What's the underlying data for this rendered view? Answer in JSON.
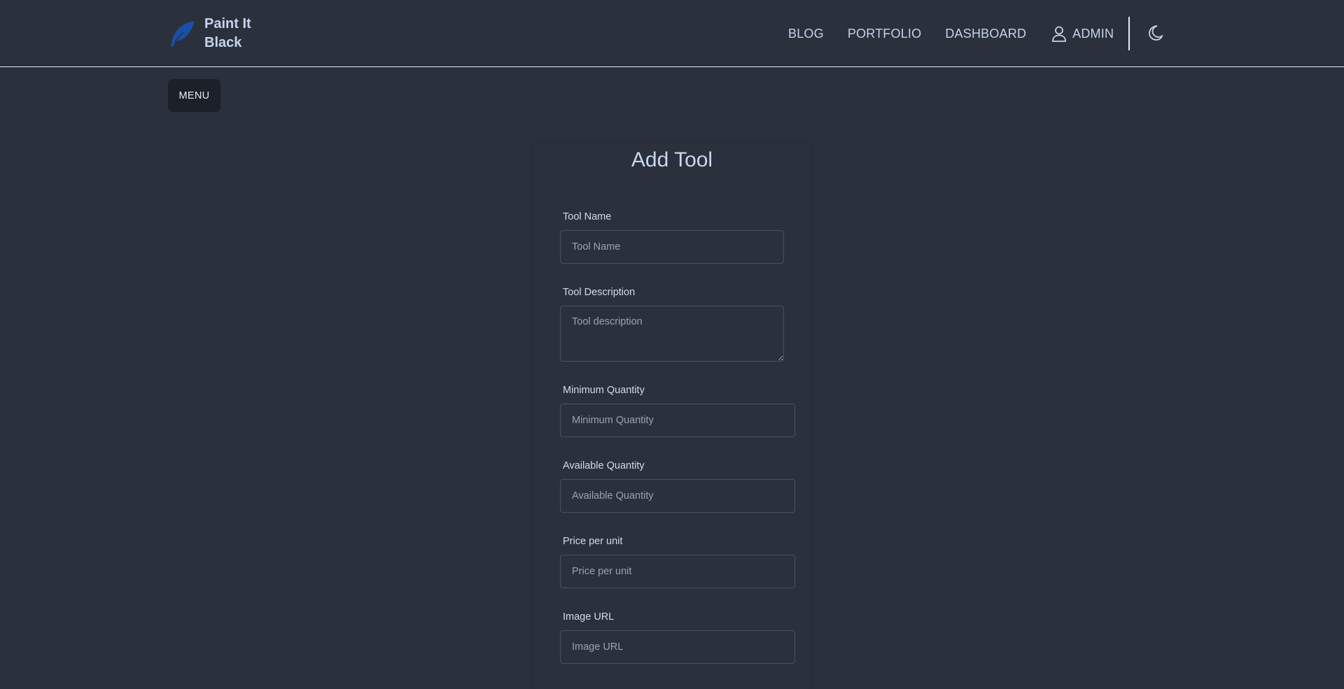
{
  "brand": {
    "line1": "Paint It",
    "line2": "Black",
    "logo_icon": "feather-icon",
    "logo_color": "#1a4fa8"
  },
  "nav": {
    "blog": "BLOG",
    "portfolio": "PORTFOLIO",
    "dashboard": "DASHBOARD",
    "admin": "ADMIN",
    "admin_icon": "user-icon",
    "theme_icon": "moon-icon"
  },
  "menu_button": "MENU",
  "form": {
    "title": "Add Tool",
    "tool_name": {
      "label": "Tool Name",
      "placeholder": "Tool Name",
      "value": ""
    },
    "tool_description": {
      "label": "Tool Description",
      "placeholder": "Tool description",
      "value": ""
    },
    "minimum_quantity": {
      "label": "Minimum Quantity",
      "placeholder": "Minimum Quantity",
      "value": ""
    },
    "available_quantity": {
      "label": "Available Quantity",
      "placeholder": "Available Quantity",
      "value": ""
    },
    "price_per_unit": {
      "label": "Price per unit",
      "placeholder": "Price per unit",
      "value": ""
    },
    "image_url": {
      "label": "Image URL",
      "placeholder": "Image URL",
      "value": ""
    }
  },
  "colors": {
    "background": "#2a303c",
    "text": "#c8d1e2",
    "menu_button_bg": "#1c2028"
  }
}
